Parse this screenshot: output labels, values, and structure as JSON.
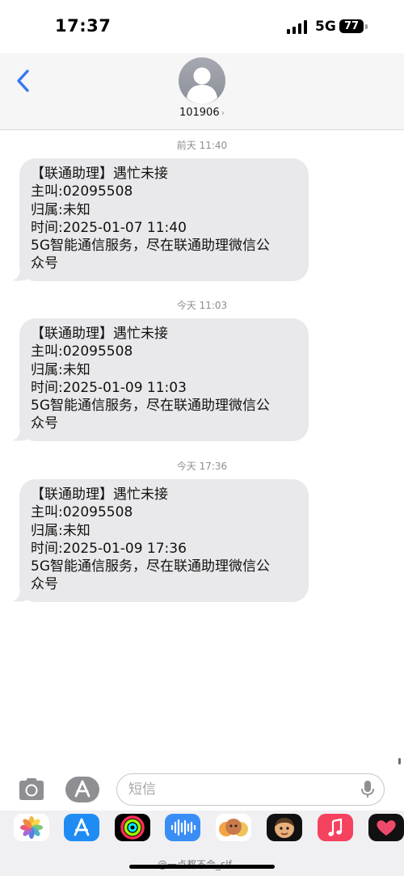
{
  "status_bar": {
    "time": "17:37",
    "network": "5G",
    "battery": "77"
  },
  "header": {
    "contact_name": "101906",
    "chevron": "›"
  },
  "messages": [
    {
      "timestamp": "前天 11:40",
      "lines": [
        "【联通助理】遇忙未接",
        "主叫:02095508",
        "归属:未知",
        "时间:2025-01-07 11:40",
        "5G智能通信服务，尽在联通助理微信公",
        "众号"
      ]
    },
    {
      "timestamp": "今天 11:03",
      "lines": [
        "【联通助理】遇忙未接",
        "主叫:02095508",
        "归属:未知",
        "时间:2025-01-09 11:03",
        "5G智能通信服务，尽在联通助理微信公",
        "众号"
      ]
    },
    {
      "timestamp": "今天 17:36",
      "lines": [
        "【联通助理】遇忙未接",
        "主叫:02095508",
        "归属:未知",
        "时间:2025-01-09 17:36",
        "5G智能通信服务，尽在联通助理微信公",
        "众号"
      ]
    }
  ],
  "composer": {
    "placeholder": "短信"
  },
  "app_tray": {
    "apps": [
      "photos-icon",
      "app-store-icon",
      "fitness-icon",
      "audio-message-icon",
      "memoji-icon",
      "memoji-stickers-icon",
      "music-icon",
      "heart-icon"
    ]
  },
  "watermark": "@一点都不会_slf"
}
